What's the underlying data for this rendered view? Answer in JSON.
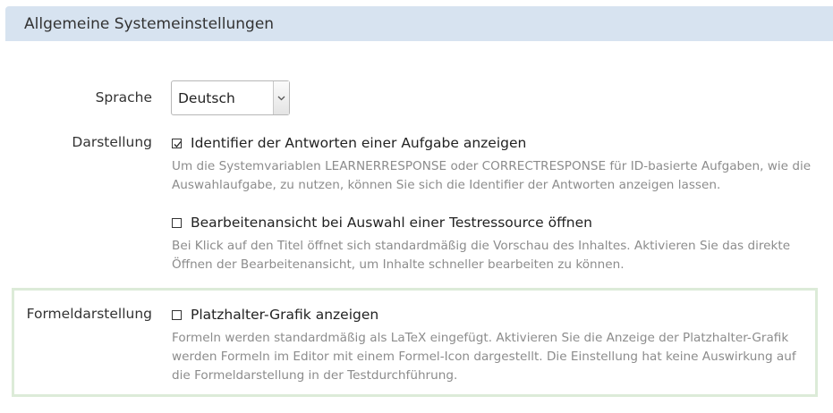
{
  "header": {
    "title": "Allgemeine Systemeinstellungen"
  },
  "language": {
    "label": "Sprache",
    "selected": "Deutsch"
  },
  "display": {
    "label": "Darstellung",
    "options": [
      {
        "label": "Identifier der Antworten einer Aufgabe anzeigen",
        "checked": true,
        "help": "Um die Systemvariablen LEARNERRESPONSE oder CORRECTRESPONSE für ID-basierte Aufgaben, wie die Auswahlaufgabe, zu nutzen, können Sie sich die Identifier der Antworten anzeigen lassen."
      },
      {
        "label": "Bearbeitenansicht bei Auswahl einer Testressource öffnen",
        "checked": false,
        "help": "Bei Klick auf den Titel öffnet sich standardmäßig die Vorschau des Inhaltes. Aktivieren Sie das direkte Öffnen der Bearbeitenansicht, um Inhalte schneller bearbeiten zu können."
      }
    ]
  },
  "formula": {
    "label": "Formeldarstellung",
    "option": {
      "label": "Platzhalter-Grafik anzeigen",
      "checked": false,
      "help": "Formeln werden standardmäßig als LaTeX eingefügt. Aktivieren Sie die Anzeige der Platzhalter-Grafik werden Formeln im Editor mit einem Formel-Icon dargestellt. Die Einstellung hat keine Auswirkung auf die Formeldarstellung in der Testdurchführung."
    }
  },
  "colors": {
    "header_bg": "#d7e3f0",
    "help_text": "#8c8c8c",
    "highlight_border": "#dcebd8"
  }
}
